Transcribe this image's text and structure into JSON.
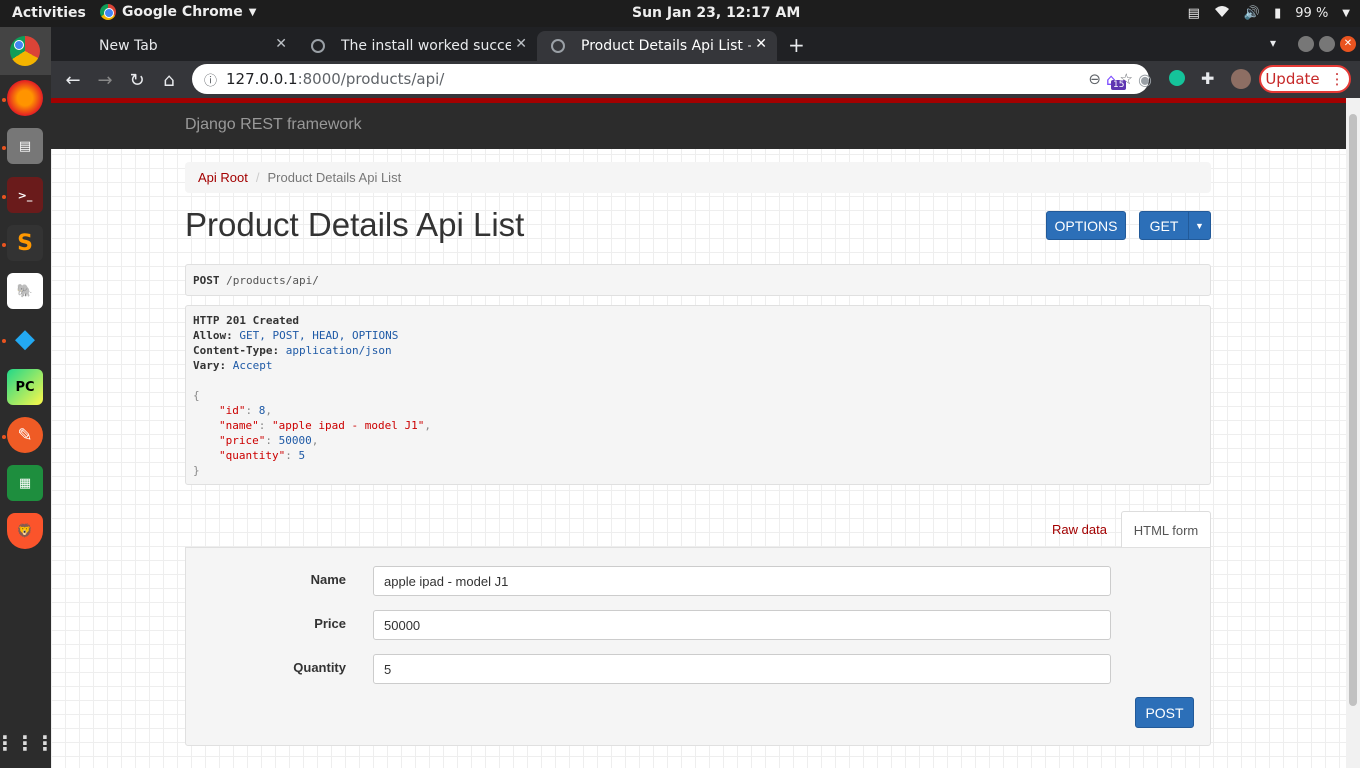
{
  "topbar": {
    "activities": "Activities",
    "app_name": "Google Chrome",
    "clock": "Sun Jan 23, 12:17 AM",
    "battery": "99 %"
  },
  "browser": {
    "tabs": [
      {
        "title": "New Tab"
      },
      {
        "title": "The install worked succes"
      },
      {
        "title": "Product Details Api List – "
      }
    ],
    "url_host": "127.0.0.1",
    "url_rest": ":8000/products/api/",
    "extension_badge": "15",
    "update_label": "Update"
  },
  "page": {
    "brand": "Django REST framework",
    "breadcrumb": {
      "root": "Api Root",
      "current": "Product Details Api List"
    },
    "title": "Product Details Api List",
    "buttons": {
      "options": "OPTIONS",
      "get": "GET",
      "post": "POST"
    },
    "request": {
      "method": "POST",
      "path": " /products/api/"
    },
    "response": {
      "status": "HTTP 201 Created",
      "headers": [
        {
          "key": "Allow:",
          "value": " GET, POST, HEAD, OPTIONS"
        },
        {
          "key": "Content-Type:",
          "value": " application/json"
        },
        {
          "key": "Vary:",
          "value": " Accept"
        }
      ],
      "body": {
        "id": {
          "key": "\"id\"",
          "value": "8"
        },
        "name": {
          "key": "\"name\"",
          "value": "\"apple ipad - model J1\""
        },
        "price": {
          "key": "\"price\"",
          "value": "50000"
        },
        "quantity": {
          "key": "\"quantity\"",
          "value": "5"
        }
      }
    },
    "form_tabs": {
      "raw": "Raw data",
      "html": "HTML form"
    },
    "form": {
      "name_label": "Name",
      "name_value": "apple ipad - model J1",
      "price_label": "Price",
      "price_value": "50000",
      "quantity_label": "Quantity",
      "quantity_value": "5"
    }
  }
}
